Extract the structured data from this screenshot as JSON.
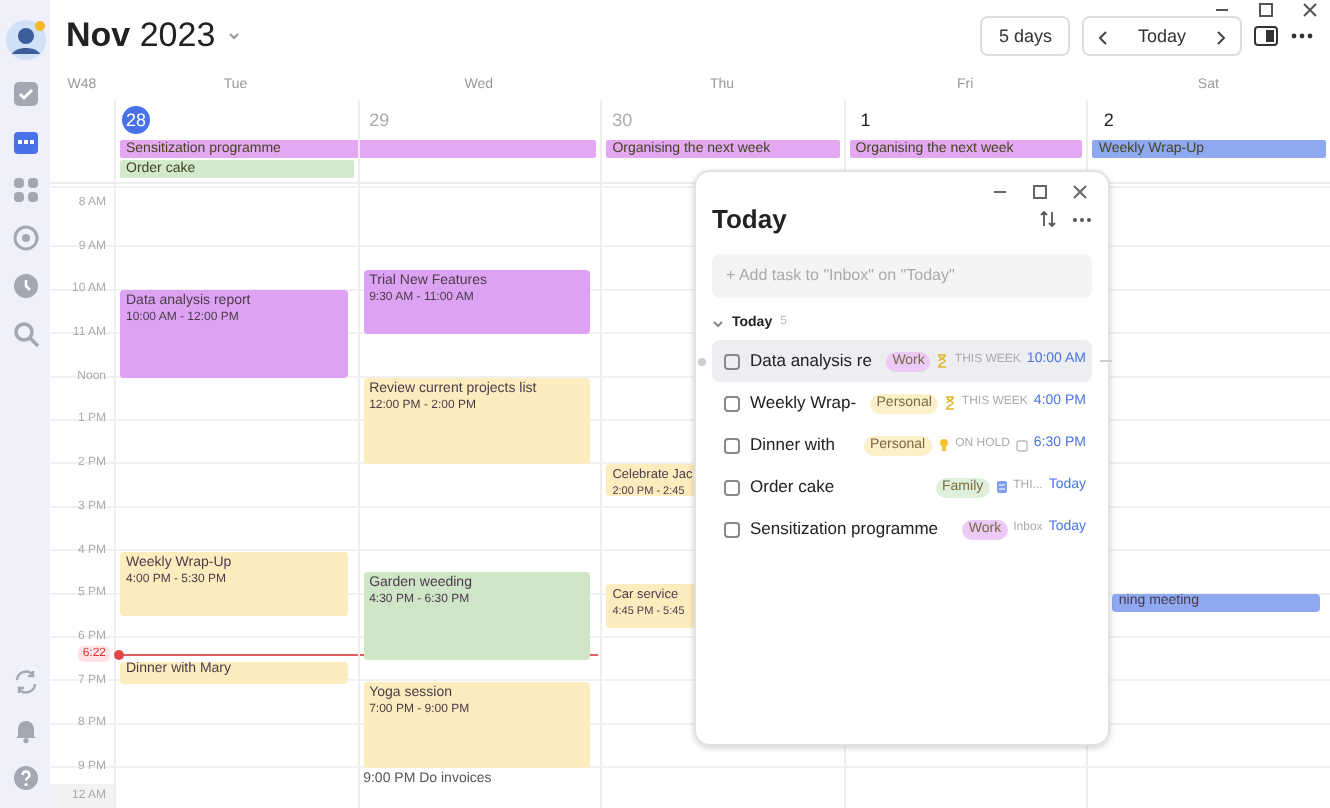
{
  "sidebar": {
    "items": [
      {
        "kind": "tasks",
        "selected": false
      },
      {
        "kind": "calendar",
        "selected": true
      },
      {
        "kind": "apps",
        "selected": false
      },
      {
        "kind": "focus",
        "selected": false
      },
      {
        "kind": "clock",
        "selected": false
      },
      {
        "kind": "search",
        "selected": false
      }
    ],
    "bottom_items": [
      {
        "kind": "sync",
        "selected": false
      },
      {
        "kind": "bell",
        "selected": false
      },
      {
        "kind": "help",
        "selected": false
      }
    ]
  },
  "header": {
    "title": "**Nov** 2023",
    "view": "5 days",
    "today_button": "Today"
  },
  "week_label": "W48",
  "days": [
    {
      "name": "Tue",
      "date": "28",
      "today": true,
      "muted": false
    },
    {
      "name": "Wed",
      "date": "29",
      "today": false,
      "muted": true
    },
    {
      "name": "Thu",
      "date": "30",
      "today": false,
      "muted": true
    },
    {
      "name": "Fri",
      "date": "1",
      "today": false,
      "muted": false
    },
    {
      "name": "Sat",
      "date": "2",
      "today": false,
      "muted": false
    }
  ],
  "all_day_events": [
    {
      "title": "Sensitization programme",
      "color": "#e4a8f2"
    },
    {
      "title": "Order cake",
      "color": "#d3e9cc"
    },
    {
      "title": "Organising the next week",
      "color": "#e4a8f2"
    },
    {
      "title": "Organising the next week",
      "color": "#e4a8f2"
    },
    {
      "title": "Weekly Wrap-Up",
      "color": "#8ea9f2"
    }
  ],
  "time_labels": [
    "8 AM",
    "9 AM",
    "10 AM",
    "11 AM",
    "Noon",
    "1 PM",
    "2 PM",
    "3 PM",
    "4 PM",
    "5 PM",
    "6 PM",
    "7 PM",
    "8 PM",
    "9 PM"
  ],
  "end_label": "12 AM",
  "now": "6:22",
  "events": [
    {
      "kind": "block",
      "title": "Data analysis report",
      "time": "10:00 AM - 12:00 PM",
      "color": "#dda3f2"
    },
    {
      "kind": "block",
      "title": "Weekly Wrap-Up",
      "time": "4:00 PM - 5:30 PM",
      "color": "#fcedbe"
    },
    {
      "kind": "block",
      "title": "Dinner with Mary",
      "color": "#fcedbe"
    },
    {
      "kind": "block",
      "title": "Trial New Features",
      "time": "9:30 AM - 11:00 AM",
      "color": "#dda3f2"
    },
    {
      "kind": "block",
      "title": "Review current projects list",
      "time": "12:00 PM - 2:00 PM",
      "color": "#fcedbe"
    },
    {
      "kind": "block",
      "title": "Garden weeding",
      "time": "4:30 PM - 6:30 PM",
      "color": "#cfe5c7"
    },
    {
      "kind": "block",
      "title": "Yoga session",
      "time": "7:00 PM - 9:00 PM",
      "color": "#fcedbe"
    },
    {
      "kind": "text",
      "title": "9:00 PM Do invoices"
    },
    {
      "kind": "block",
      "title": "Celebrate Jac",
      "time": "2:00 PM - 2:45",
      "color": "#fcedbe"
    },
    {
      "kind": "block",
      "title": "Car service",
      "time": "4:45 PM - 5:45",
      "color": "#fcedbe"
    },
    {
      "kind": "block",
      "title": "ning meeting",
      "color": "#8ea9f2"
    }
  ],
  "popup": {
    "title": "Today",
    "placeholder": "+ Add task to \"Inbox\" on \"Today\"",
    "section": {
      "title": "Today",
      "count": "5",
      "expanded": true
    },
    "tasks": [
      {
        "title": "Data analysis re",
        "checked": false,
        "hovered": true,
        "tag": {
          "label": "Work",
          "color": "#ecc9f7"
        },
        "status": {
          "kind": "hourglass",
          "text": "THIS WEEK"
        },
        "calendar_icon": false,
        "time": "10:00 AM"
      },
      {
        "title": "Weekly Wrap-",
        "checked": false,
        "hovered": false,
        "tag": {
          "label": "Personal",
          "color": "#fbf0c9"
        },
        "status": {
          "kind": "hourglass",
          "text": "THIS WEEK"
        },
        "calendar_icon": false,
        "time": "4:00 PM"
      },
      {
        "title": "Dinner with",
        "checked": false,
        "hovered": false,
        "tag": {
          "label": "Personal",
          "color": "#fbf0c9"
        },
        "status": {
          "kind": "bulb",
          "text": "ON HOLD"
        },
        "calendar_icon": true,
        "time": "6:30 PM"
      },
      {
        "title": "Order cake",
        "checked": false,
        "hovered": false,
        "tag": {
          "label": "Family",
          "color": "#dff0da"
        },
        "status": {
          "kind": "list",
          "text": "THI..."
        },
        "calendar_icon": false,
        "time": "Today"
      },
      {
        "title": "Sensitization programme",
        "checked": false,
        "hovered": false,
        "tag": {
          "label": "Work",
          "color": "#ecc9f7"
        },
        "status": {
          "kind": "plain",
          "text": "Inbox"
        },
        "calendar_icon": false,
        "time": "Today"
      }
    ]
  }
}
